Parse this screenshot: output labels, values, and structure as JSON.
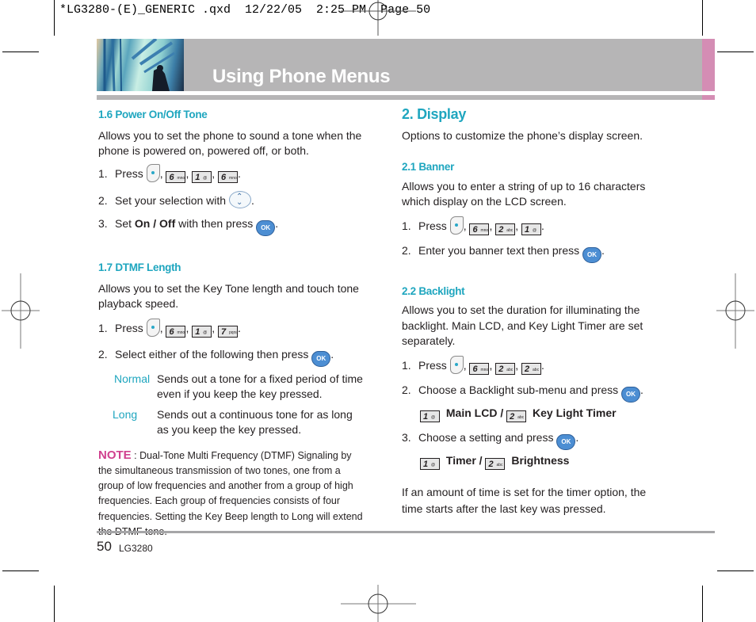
{
  "slug": "*LG3280-(E)_GENERIC .qxd  12/22/05  2:25 PM  Page 50",
  "header": {
    "title": "Using Phone Menus",
    "bar_color": "#b6b5b6",
    "accent_color": "#d48db4"
  },
  "colors": {
    "heading": "#1fa6bf",
    "note": "#d0418e",
    "text": "#231f20"
  },
  "left": {
    "sec16": {
      "title": "1.6 Power On/Off Tone",
      "body": "Allows you to set the phone to sound a tone when the phone is powered on, powered off, or both.",
      "step1_num": "1.",
      "step1_text": "Press",
      "step1_keys": [
        {
          "n": "6",
          "s": "mno"
        },
        {
          "n": "1",
          "s": "@"
        },
        {
          "n": "6",
          "s": "mno"
        }
      ],
      "step2_num": "2.",
      "step2_text": "Set your selection with",
      "step3_num": "3.",
      "step3_pre": "Set",
      "step3_bold": "On / Off",
      "step3_post": "with  then press"
    },
    "sec17": {
      "title": "1.7 DTMF Length",
      "body": "Allows you to set the Key Tone length and touch tone playback speed.",
      "step1_num": "1.",
      "step1_text": "Press",
      "step1_keys": [
        {
          "n": "6",
          "s": "mno"
        },
        {
          "n": "1",
          "s": "@"
        },
        {
          "n": "7",
          "s": "pqrs"
        }
      ],
      "step2_num": "2.",
      "step2_text": "Select either of the following then press",
      "options": [
        {
          "term": "Normal",
          "desc": "Sends out a tone for a fixed period of time even if you keep the key pressed."
        },
        {
          "term": "Long",
          "desc": "Sends out a continuous tone for as long as you keep the key pressed."
        }
      ]
    },
    "note": {
      "label": "NOTE",
      "text": " : Dual-Tone Multi Frequency (DTMF) Signaling by the simultaneous transmission of two tones, one from a group of low frequencies and another from a group of high frequencies. Each group of frequencies consists of four frequencies. Setting the Key Beep length to Long will extend the DTMF tone."
    }
  },
  "right": {
    "sec2": {
      "title": "2. Display",
      "body": "Options to customize the phone’s display screen."
    },
    "sec21": {
      "title": "2.1 Banner",
      "body": "Allows you to enter a string of up to 16 characters which display on the LCD screen.",
      "step1_num": "1.",
      "step1_text": "Press",
      "step1_keys": [
        {
          "n": "6",
          "s": "mno"
        },
        {
          "n": "2",
          "s": "abc"
        },
        {
          "n": "1",
          "s": "@"
        }
      ],
      "step2_num": "2.",
      "step2_text": "Enter you banner text then press"
    },
    "sec22": {
      "title": "2.2 Backlight",
      "body": "Allows you to set the duration for illuminating the backlight. Main LCD, and Key Light Timer are set separately.",
      "step1_num": "1.",
      "step1_text": "Press",
      "step1_keys": [
        {
          "n": "6",
          "s": "mno"
        },
        {
          "n": "2",
          "s": "abc"
        },
        {
          "n": "2",
          "s": "abc"
        }
      ],
      "step2_num": "2.",
      "step2_text": "Choose a Backlight sub-menu and press",
      "step2_opts": [
        {
          "n": "1",
          "s": "@",
          "label": "Main LCD /"
        },
        {
          "n": "2",
          "s": "abc",
          "label": "Key Light Timer"
        }
      ],
      "step3_num": "3.",
      "step3_text": "Choose a setting and press",
      "step3_opts": [
        {
          "n": "1",
          "s": "@",
          "label": "Timer /"
        },
        {
          "n": "2",
          "s": "abc",
          "label": "Brightness"
        }
      ],
      "footer": "If an amount of time is set for the timer option, the time starts after the last key was pressed."
    }
  },
  "icons": {
    "menu": "menu-soft-key-icon",
    "nav": "navigation-key-icon",
    "ok": "ok-key-icon",
    "ok_label": "OK"
  },
  "footer": {
    "page": "50",
    "model": "LG3280"
  }
}
